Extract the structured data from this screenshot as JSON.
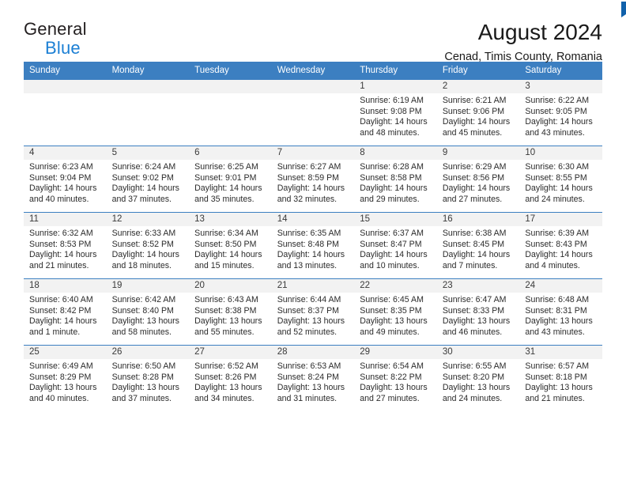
{
  "brand": {
    "line1": "General",
    "line2": "Blue",
    "flag_icon": "triangle-flag-icon",
    "accent_color": "#1b7fd4",
    "flag_color": "#1061ab"
  },
  "header": {
    "title": "August 2024",
    "subtitle": "Cenad, Timis County, Romania"
  },
  "theme": {
    "header_row_bg": "#3c7fc1",
    "header_row_text": "#ffffff",
    "daynum_band_bg": "#f2f2f2",
    "row_separator": "#3c7fc1"
  },
  "calendar": {
    "weekday_headers": [
      "Sunday",
      "Monday",
      "Tuesday",
      "Wednesday",
      "Thursday",
      "Friday",
      "Saturday"
    ],
    "weeks": [
      [
        {
          "day": "",
          "empty": true,
          "sunrise": "",
          "sunset": "",
          "daylight1": "",
          "daylight2": ""
        },
        {
          "day": "",
          "empty": true,
          "sunrise": "",
          "sunset": "",
          "daylight1": "",
          "daylight2": ""
        },
        {
          "day": "",
          "empty": true,
          "sunrise": "",
          "sunset": "",
          "daylight1": "",
          "daylight2": ""
        },
        {
          "day": "",
          "empty": true,
          "sunrise": "",
          "sunset": "",
          "daylight1": "",
          "daylight2": ""
        },
        {
          "day": "1",
          "empty": false,
          "sunrise": "Sunrise: 6:19 AM",
          "sunset": "Sunset: 9:08 PM",
          "daylight1": "Daylight: 14 hours",
          "daylight2": "and 48 minutes."
        },
        {
          "day": "2",
          "empty": false,
          "sunrise": "Sunrise: 6:21 AM",
          "sunset": "Sunset: 9:06 PM",
          "daylight1": "Daylight: 14 hours",
          "daylight2": "and 45 minutes."
        },
        {
          "day": "3",
          "empty": false,
          "sunrise": "Sunrise: 6:22 AM",
          "sunset": "Sunset: 9:05 PM",
          "daylight1": "Daylight: 14 hours",
          "daylight2": "and 43 minutes."
        }
      ],
      [
        {
          "day": "4",
          "empty": false,
          "sunrise": "Sunrise: 6:23 AM",
          "sunset": "Sunset: 9:04 PM",
          "daylight1": "Daylight: 14 hours",
          "daylight2": "and 40 minutes."
        },
        {
          "day": "5",
          "empty": false,
          "sunrise": "Sunrise: 6:24 AM",
          "sunset": "Sunset: 9:02 PM",
          "daylight1": "Daylight: 14 hours",
          "daylight2": "and 37 minutes."
        },
        {
          "day": "6",
          "empty": false,
          "sunrise": "Sunrise: 6:25 AM",
          "sunset": "Sunset: 9:01 PM",
          "daylight1": "Daylight: 14 hours",
          "daylight2": "and 35 minutes."
        },
        {
          "day": "7",
          "empty": false,
          "sunrise": "Sunrise: 6:27 AM",
          "sunset": "Sunset: 8:59 PM",
          "daylight1": "Daylight: 14 hours",
          "daylight2": "and 32 minutes."
        },
        {
          "day": "8",
          "empty": false,
          "sunrise": "Sunrise: 6:28 AM",
          "sunset": "Sunset: 8:58 PM",
          "daylight1": "Daylight: 14 hours",
          "daylight2": "and 29 minutes."
        },
        {
          "day": "9",
          "empty": false,
          "sunrise": "Sunrise: 6:29 AM",
          "sunset": "Sunset: 8:56 PM",
          "daylight1": "Daylight: 14 hours",
          "daylight2": "and 27 minutes."
        },
        {
          "day": "10",
          "empty": false,
          "sunrise": "Sunrise: 6:30 AM",
          "sunset": "Sunset: 8:55 PM",
          "daylight1": "Daylight: 14 hours",
          "daylight2": "and 24 minutes."
        }
      ],
      [
        {
          "day": "11",
          "empty": false,
          "sunrise": "Sunrise: 6:32 AM",
          "sunset": "Sunset: 8:53 PM",
          "daylight1": "Daylight: 14 hours",
          "daylight2": "and 21 minutes."
        },
        {
          "day": "12",
          "empty": false,
          "sunrise": "Sunrise: 6:33 AM",
          "sunset": "Sunset: 8:52 PM",
          "daylight1": "Daylight: 14 hours",
          "daylight2": "and 18 minutes."
        },
        {
          "day": "13",
          "empty": false,
          "sunrise": "Sunrise: 6:34 AM",
          "sunset": "Sunset: 8:50 PM",
          "daylight1": "Daylight: 14 hours",
          "daylight2": "and 15 minutes."
        },
        {
          "day": "14",
          "empty": false,
          "sunrise": "Sunrise: 6:35 AM",
          "sunset": "Sunset: 8:48 PM",
          "daylight1": "Daylight: 14 hours",
          "daylight2": "and 13 minutes."
        },
        {
          "day": "15",
          "empty": false,
          "sunrise": "Sunrise: 6:37 AM",
          "sunset": "Sunset: 8:47 PM",
          "daylight1": "Daylight: 14 hours",
          "daylight2": "and 10 minutes."
        },
        {
          "day": "16",
          "empty": false,
          "sunrise": "Sunrise: 6:38 AM",
          "sunset": "Sunset: 8:45 PM",
          "daylight1": "Daylight: 14 hours",
          "daylight2": "and 7 minutes."
        },
        {
          "day": "17",
          "empty": false,
          "sunrise": "Sunrise: 6:39 AM",
          "sunset": "Sunset: 8:43 PM",
          "daylight1": "Daylight: 14 hours",
          "daylight2": "and 4 minutes."
        }
      ],
      [
        {
          "day": "18",
          "empty": false,
          "sunrise": "Sunrise: 6:40 AM",
          "sunset": "Sunset: 8:42 PM",
          "daylight1": "Daylight: 14 hours",
          "daylight2": "and 1 minute."
        },
        {
          "day": "19",
          "empty": false,
          "sunrise": "Sunrise: 6:42 AM",
          "sunset": "Sunset: 8:40 PM",
          "daylight1": "Daylight: 13 hours",
          "daylight2": "and 58 minutes."
        },
        {
          "day": "20",
          "empty": false,
          "sunrise": "Sunrise: 6:43 AM",
          "sunset": "Sunset: 8:38 PM",
          "daylight1": "Daylight: 13 hours",
          "daylight2": "and 55 minutes."
        },
        {
          "day": "21",
          "empty": false,
          "sunrise": "Sunrise: 6:44 AM",
          "sunset": "Sunset: 8:37 PM",
          "daylight1": "Daylight: 13 hours",
          "daylight2": "and 52 minutes."
        },
        {
          "day": "22",
          "empty": false,
          "sunrise": "Sunrise: 6:45 AM",
          "sunset": "Sunset: 8:35 PM",
          "daylight1": "Daylight: 13 hours",
          "daylight2": "and 49 minutes."
        },
        {
          "day": "23",
          "empty": false,
          "sunrise": "Sunrise: 6:47 AM",
          "sunset": "Sunset: 8:33 PM",
          "daylight1": "Daylight: 13 hours",
          "daylight2": "and 46 minutes."
        },
        {
          "day": "24",
          "empty": false,
          "sunrise": "Sunrise: 6:48 AM",
          "sunset": "Sunset: 8:31 PM",
          "daylight1": "Daylight: 13 hours",
          "daylight2": "and 43 minutes."
        }
      ],
      [
        {
          "day": "25",
          "empty": false,
          "sunrise": "Sunrise: 6:49 AM",
          "sunset": "Sunset: 8:29 PM",
          "daylight1": "Daylight: 13 hours",
          "daylight2": "and 40 minutes."
        },
        {
          "day": "26",
          "empty": false,
          "sunrise": "Sunrise: 6:50 AM",
          "sunset": "Sunset: 8:28 PM",
          "daylight1": "Daylight: 13 hours",
          "daylight2": "and 37 minutes."
        },
        {
          "day": "27",
          "empty": false,
          "sunrise": "Sunrise: 6:52 AM",
          "sunset": "Sunset: 8:26 PM",
          "daylight1": "Daylight: 13 hours",
          "daylight2": "and 34 minutes."
        },
        {
          "day": "28",
          "empty": false,
          "sunrise": "Sunrise: 6:53 AM",
          "sunset": "Sunset: 8:24 PM",
          "daylight1": "Daylight: 13 hours",
          "daylight2": "and 31 minutes."
        },
        {
          "day": "29",
          "empty": false,
          "sunrise": "Sunrise: 6:54 AM",
          "sunset": "Sunset: 8:22 PM",
          "daylight1": "Daylight: 13 hours",
          "daylight2": "and 27 minutes."
        },
        {
          "day": "30",
          "empty": false,
          "sunrise": "Sunrise: 6:55 AM",
          "sunset": "Sunset: 8:20 PM",
          "daylight1": "Daylight: 13 hours",
          "daylight2": "and 24 minutes."
        },
        {
          "day": "31",
          "empty": false,
          "sunrise": "Sunrise: 6:57 AM",
          "sunset": "Sunset: 8:18 PM",
          "daylight1": "Daylight: 13 hours",
          "daylight2": "and 21 minutes."
        }
      ]
    ]
  }
}
